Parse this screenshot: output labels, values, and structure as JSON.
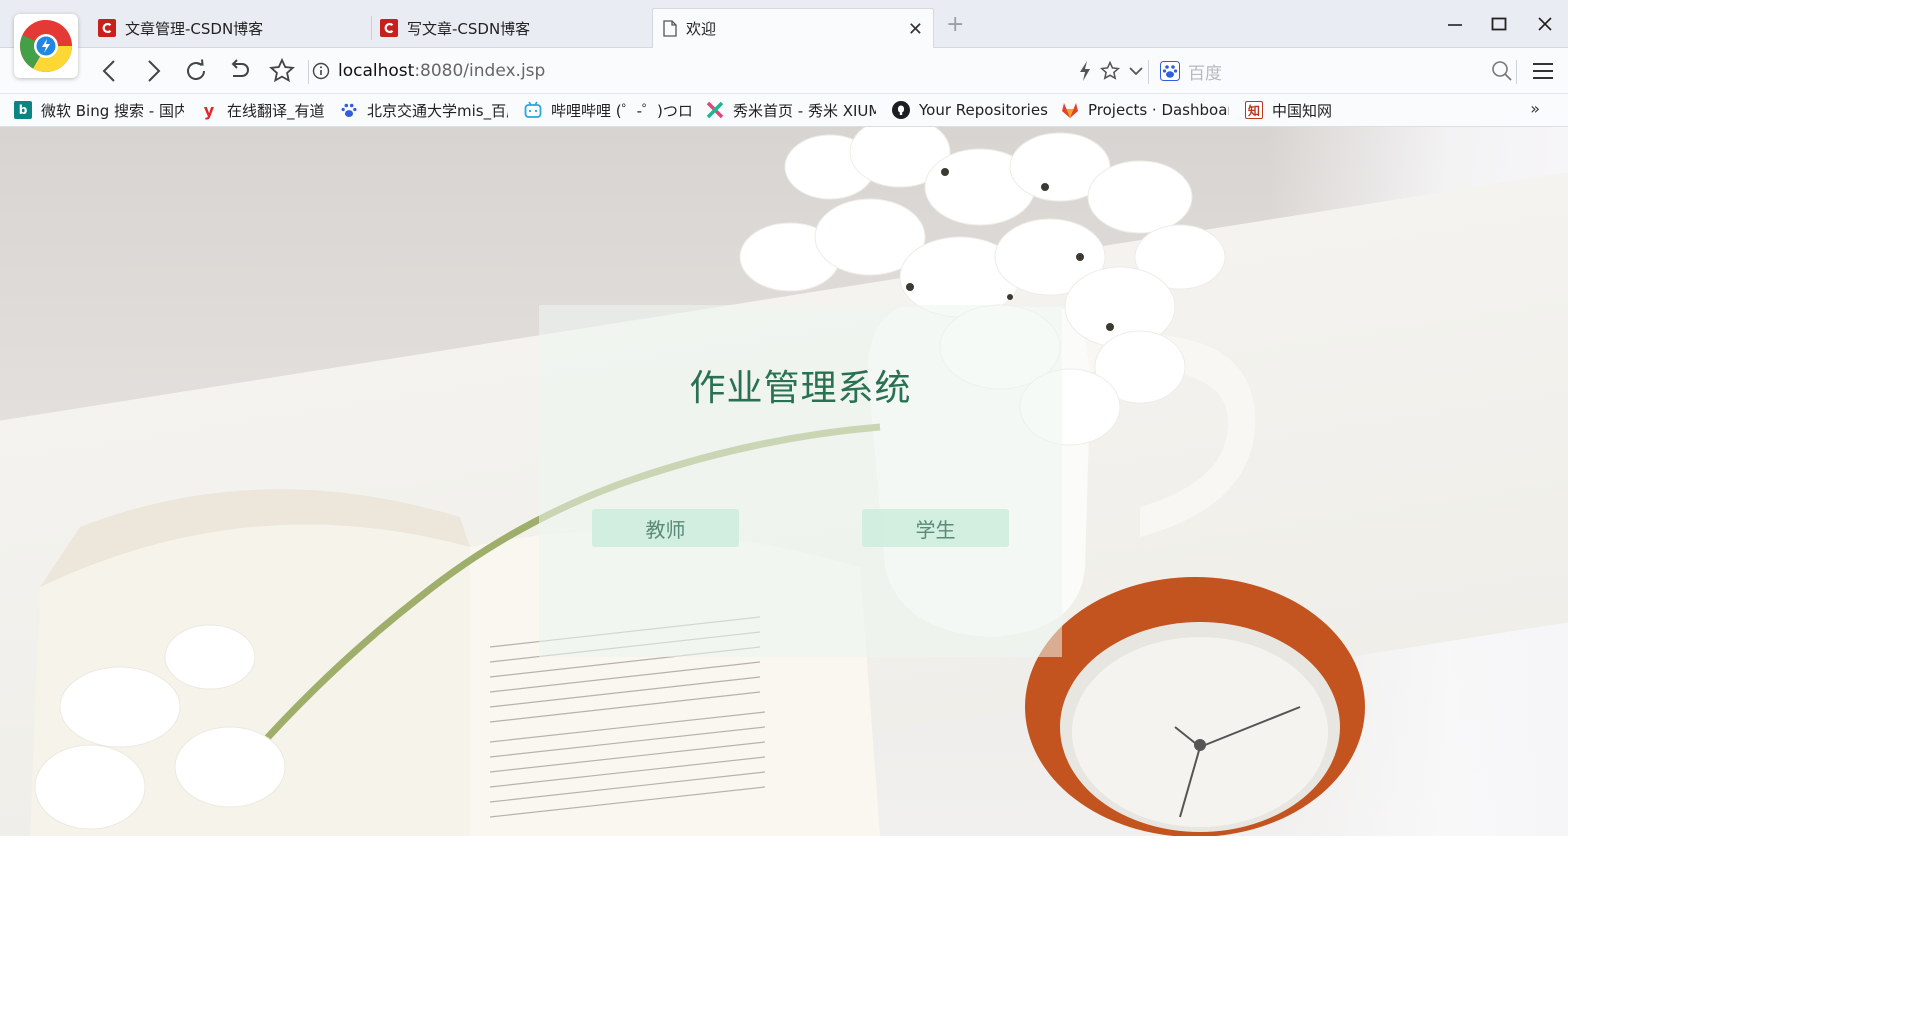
{
  "tabs": [
    {
      "title": "文章管理-CSDN博客",
      "icon": "csdn-icon",
      "active": false
    },
    {
      "title": "写文章-CSDN博客",
      "icon": "csdn-icon",
      "active": false
    },
    {
      "title": "欢迎",
      "icon": "document-icon",
      "active": true
    }
  ],
  "address_bar": {
    "url_host": "localhost",
    "url_rest": ":8080/index.jsp"
  },
  "search": {
    "placeholder": "百度"
  },
  "bookmarks": [
    {
      "label": "微软 Bing 搜索 - 国内",
      "icon": "bing-icon",
      "color": "#0c8484"
    },
    {
      "label": "在线翻译_有道",
      "icon": "youdao-icon",
      "color": "#e4252b"
    },
    {
      "label": "北京交通大学mis_百度",
      "icon": "baidu-paw-icon",
      "color": "#2f5fe0"
    },
    {
      "label": "哔哩哔哩 (゜-゜)つロ",
      "icon": "bilibili-icon",
      "color": "#23a8e0"
    },
    {
      "label": "秀米首页 - 秀米 XIUMI",
      "icon": "xiumi-icon",
      "color": "#e0457a"
    },
    {
      "label": "Your Repositories",
      "icon": "github-icon",
      "color": "#1b1f23"
    },
    {
      "label": "Projects · Dashboard",
      "icon": "gitlab-icon",
      "color": "#e24329"
    },
    {
      "label": "中国知网",
      "icon": "cnki-icon",
      "color": "#b33a1a"
    }
  ],
  "main": {
    "title": "作业管理系统",
    "buttons": {
      "teacher": "教师",
      "student": "学生"
    }
  },
  "colors": {
    "title": "#2a7152",
    "button_bg": "#ceeede",
    "button_text": "#5a8a77",
    "csdn_red": "#c8201c"
  }
}
